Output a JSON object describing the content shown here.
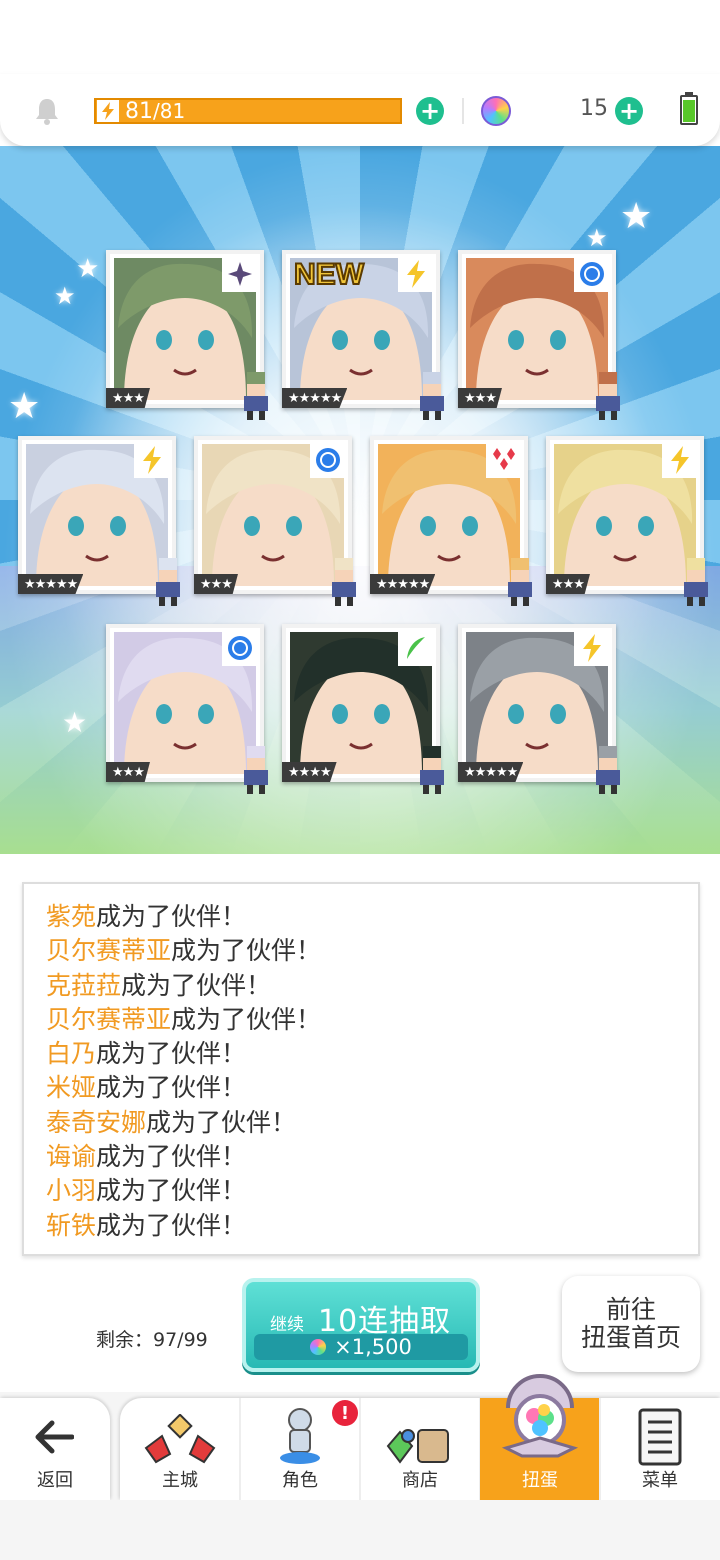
{
  "status": {
    "stamina_value": "81",
    "stamina_max": "/81",
    "gem_count": "15"
  },
  "cards": [
    {
      "stars": "★★★",
      "element": "dark",
      "color": "#6e8a63",
      "hair": "#7e9a6a",
      "is_new": false
    },
    {
      "stars": "★★★★★",
      "element": "thunder",
      "color": "#b8c4d8",
      "hair": "#c9d3e6",
      "is_new": true
    },
    {
      "stars": "★★★",
      "element": "water",
      "color": "#d98a5c",
      "hair": "#c0704a",
      "is_new": false
    },
    {
      "stars": "★★★★★",
      "element": "thunder",
      "color": "#c9d0e0",
      "hair": "#dce3f0",
      "is_new": false
    },
    {
      "stars": "★★★",
      "element": "water",
      "color": "#e8d7b5",
      "hair": "#f0e3c6",
      "is_new": false
    },
    {
      "stars": "★★★★★",
      "element": "fire",
      "color": "#f2b25a",
      "hair": "#f0c070",
      "is_new": false
    },
    {
      "stars": "★★★",
      "element": "thunder",
      "color": "#e6d28a",
      "hair": "#efe0a0",
      "is_new": false
    },
    {
      "stars": "★★★",
      "element": "water",
      "color": "#d2cbe6",
      "hair": "#e0dbf0",
      "is_new": false
    },
    {
      "stars": "★★★★",
      "element": "wind",
      "color": "#2f3a30",
      "hair": "#22302a",
      "is_new": false
    },
    {
      "stars": "★★★★★",
      "element": "thunder",
      "color": "#7d8288",
      "hair": "#9aa0a6",
      "is_new": false
    }
  ],
  "new_label": "NEW",
  "messages": [
    {
      "name": "紫苑",
      "suffix": "成为了伙伴！"
    },
    {
      "name": "贝尔赛蒂亚",
      "suffix": "成为了伙伴！"
    },
    {
      "name": "克菈菈",
      "suffix": "成为了伙伴！"
    },
    {
      "name": "贝尔赛蒂亚",
      "suffix": "成为了伙伴！"
    },
    {
      "name": "白乃",
      "suffix": "成为了伙伴！"
    },
    {
      "name": "米娅",
      "suffix": "成为了伙伴！"
    },
    {
      "name": "泰奇安娜",
      "suffix": "成为了伙伴！"
    },
    {
      "name": "诲谕",
      "suffix": "成为了伙伴！"
    },
    {
      "name": "小羽",
      "suffix": "成为了伙伴！"
    },
    {
      "name": "斩铁",
      "suffix": "成为了伙伴！"
    }
  ],
  "gacha": {
    "remaining": "剩余：97/99",
    "continue_label": "继续",
    "draw_label": "10连抽取",
    "cost": "×1,500",
    "home_label_line1": "前往",
    "home_label_line2": "扭蛋首页"
  },
  "nav": {
    "back": "返回",
    "items": [
      "主城",
      "角色",
      "商店",
      "扭蛋",
      "菜单"
    ],
    "active": "扭蛋",
    "badge": "!"
  },
  "colors": {
    "accent_orange": "#f7a21b",
    "name_orange": "#f19a22",
    "teal": "#27b9b4",
    "plus_green": "#1fbf8f"
  }
}
